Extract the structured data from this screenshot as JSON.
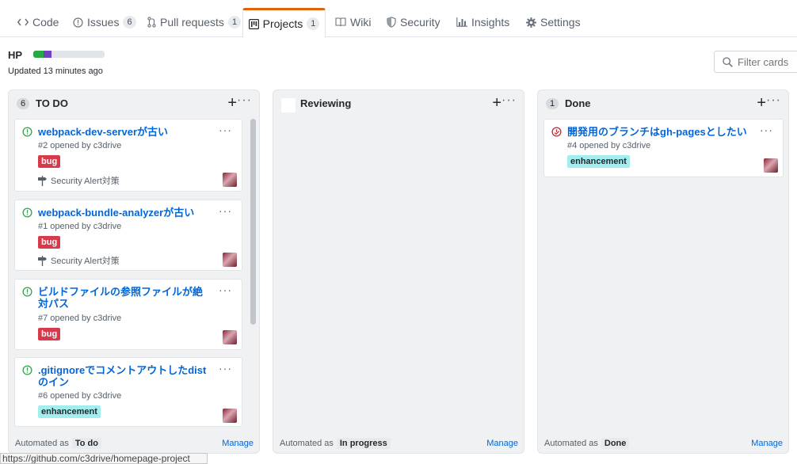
{
  "tabs": [
    {
      "label": "Code",
      "icon": "code-icon",
      "count": ""
    },
    {
      "label": "Issues",
      "icon": "issue-icon",
      "count": "6"
    },
    {
      "label": "Pull requests",
      "icon": "pull-request-icon",
      "count": "1"
    },
    {
      "label": "Projects",
      "icon": "project-icon",
      "count": "1"
    },
    {
      "label": "Wiki",
      "icon": "book-icon",
      "count": ""
    },
    {
      "label": "Security",
      "icon": "shield-icon",
      "count": ""
    },
    {
      "label": "Insights",
      "icon": "graph-icon",
      "count": ""
    },
    {
      "label": "Settings",
      "icon": "gear-icon",
      "count": ""
    }
  ],
  "project": {
    "name": "HP",
    "progress_done": 0.14,
    "progress_in_progress": 0.12,
    "updated": "Updated 13 minutes ago",
    "filter_placeholder": "Filter cards"
  },
  "colors": {
    "accent": "#e36209",
    "link": "#0366d6",
    "open": "#28a745",
    "closed": "#cb2431",
    "bug": "#d73a4a",
    "enhancement": "#a2eeef"
  },
  "columns": [
    {
      "count": "6",
      "title": "TO DO",
      "automated_label": "Automated as",
      "automated_value": "To do",
      "manage": "Manage",
      "cards": [
        {
          "title": "webpack-dev-serverが古い",
          "meta": "#2 opened by c3drive",
          "label": "bug",
          "milestone": "Security Alert対策"
        },
        {
          "title": "webpack-bundle-analyzerが古い",
          "meta": "#1 opened by c3drive",
          "label": "bug",
          "milestone": "Security Alert対策"
        },
        {
          "title": "ビルドファイルの参照ファイルが絶対パス",
          "meta": "#7 opened by c3drive",
          "label": "bug",
          "milestone": ""
        },
        {
          "title": ".gitignoreでコメントアウトしたdistのイン",
          "meta": "#6 opened by c3drive",
          "label": "enhancement",
          "milestone": ""
        }
      ]
    },
    {
      "count": "",
      "title": "Reviewing",
      "automated_label": "Automated as",
      "automated_value": "In progress",
      "manage": "Manage",
      "cards": []
    },
    {
      "count": "1",
      "title": "Done",
      "automated_label": "Automated as",
      "automated_value": "Done",
      "manage": "Manage",
      "cards": [
        {
          "title": "開発用のブランチはgh-pagesとしたい",
          "meta": "#4 opened by c3drive",
          "label": "enhancement",
          "milestone": ""
        }
      ]
    }
  ],
  "status_bar": "https://github.com/c3drive/homepage-project"
}
